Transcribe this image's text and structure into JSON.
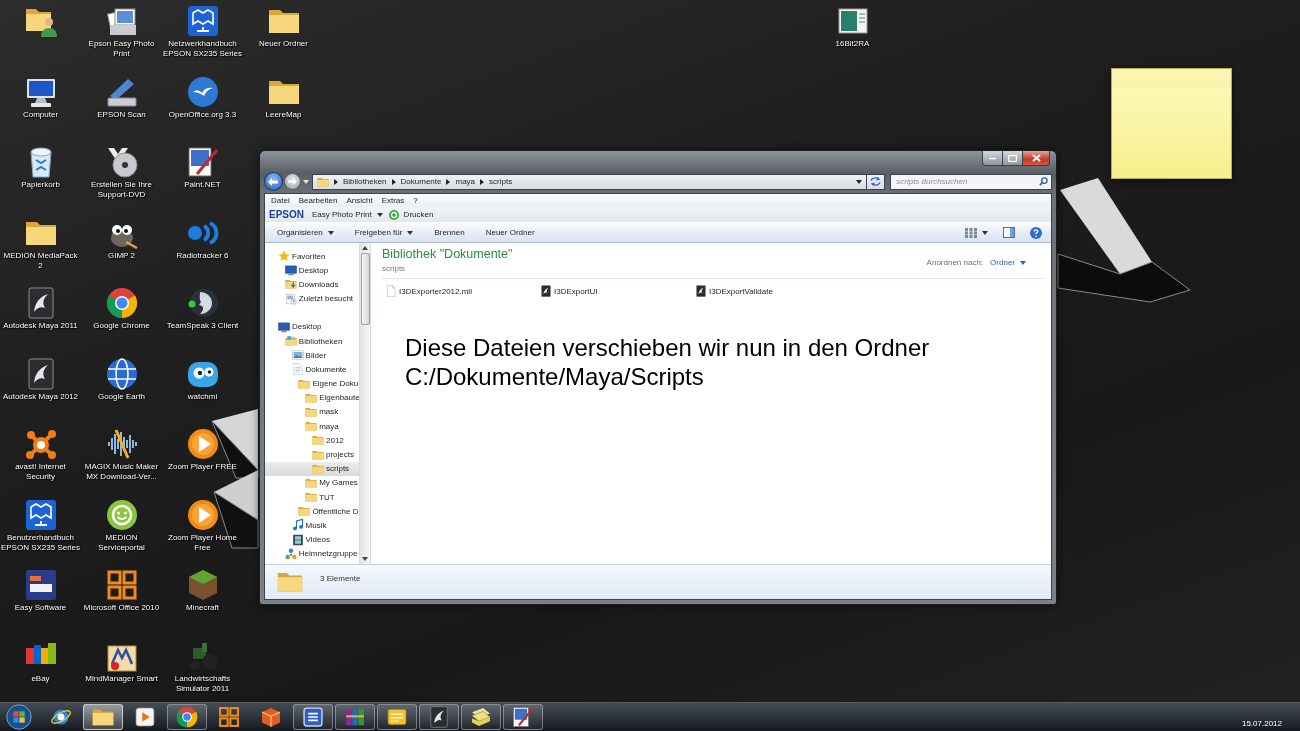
{
  "desktop": {
    "icon_columns": [
      [
        {
          "kind": "user-folder"
        },
        {
          "label": "Computer",
          "kind": "computer"
        },
        {
          "label": "Papierkorb",
          "kind": "trash"
        },
        {
          "label": "MEDION MediaPack 2",
          "kind": "folder"
        },
        {
          "label": "Autodesk Maya 2011",
          "kind": "maya"
        },
        {
          "label": "Autodesk Maya 2012",
          "kind": "maya"
        },
        {
          "label": "avast! Internet Security",
          "kind": "avast"
        },
        {
          "label": "Benutzerhandbuch EPSON SX235 Series",
          "kind": "manual"
        },
        {
          "label": "Easy Software",
          "kind": "mugle"
        },
        {
          "label": "eBay",
          "kind": "ebay"
        }
      ],
      [
        {
          "label": "Epson Easy Photo Print",
          "kind": "photos"
        },
        {
          "label": "EPSON Scan",
          "kind": "scanner"
        },
        {
          "label": "Erstellen Sie Ihre Support-DVD",
          "kind": "disc"
        },
        {
          "label": "GIMP 2",
          "kind": "gimp"
        },
        {
          "label": "Google Chrome",
          "kind": "chrome"
        },
        {
          "label": "Google Earth",
          "kind": "earth"
        },
        {
          "label": "MAGIX Music Maker MX Download-Ver...",
          "kind": "waveform"
        },
        {
          "label": "MEDION Serviceportal",
          "kind": "smiley"
        },
        {
          "label": "Microsoft Office 2010",
          "kind": "office"
        },
        {
          "label": "MindManager Smart",
          "kind": "mindmanager"
        }
      ],
      [
        {
          "label": "Netzwerkhandbuch EPSON SX235 Series",
          "kind": "manual"
        },
        {
          "label": "OpenOffice.org 3.3",
          "kind": "openoffice"
        },
        {
          "label": "Paint.NET",
          "kind": "paint"
        },
        {
          "label": "Radiotracker 6",
          "kind": "radio"
        },
        {
          "label": "TeamSpeak 3 Client",
          "kind": "teamspeak"
        },
        {
          "label": "watchmi",
          "kind": "watchmi"
        },
        {
          "label": "Zoom Player FREE",
          "kind": "play"
        },
        {
          "label": "Zoom Player Home Free",
          "kind": "play"
        },
        {
          "label": "Minecraft",
          "kind": "grass"
        },
        {
          "label": "Landwirtschafts Simulator 2011",
          "kind": "tractor"
        }
      ],
      [
        {
          "label": "Neuer Ordner",
          "kind": "folder"
        },
        {
          "label": "LeereMap",
          "kind": "folder"
        }
      ]
    ],
    "far_icons": [
      {
        "label": "16Bit2RA",
        "kind": "image"
      }
    ]
  },
  "explorer": {
    "history": {
      "back_disabled": false,
      "forward_disabled": true
    },
    "breadcrumb": [
      "Bibliotheken",
      "Dokumente",
      "maya",
      "scripts"
    ],
    "search": {
      "placeholder": "scripts durchsuchen"
    },
    "menu": [
      "Datei",
      "Bearbeiten",
      "Ansicht",
      "Extras",
      "?"
    ],
    "epson_bar": {
      "brand": "EPSON",
      "app": "Easy Photo Print",
      "print": "Drucken"
    },
    "commands": [
      {
        "label": "Organisieren",
        "dropdown": true
      },
      {
        "label": "Freigeben für",
        "dropdown": true
      },
      {
        "label": "Brennen",
        "dropdown": false
      },
      {
        "label": "Neuer Ordner",
        "dropdown": false
      }
    ],
    "nav": [
      {
        "label": "Favoriten",
        "kind": "star",
        "selected": false,
        "children": [
          {
            "label": "Desktop",
            "kind": "desktop",
            "selected": false
          },
          {
            "label": "Downloads",
            "kind": "download",
            "selected": false
          },
          {
            "label": "Zuletzt besucht",
            "kind": "recent",
            "selected": false
          }
        ]
      },
      {
        "label": "Desktop",
        "kind": "desktop",
        "selected": false,
        "children": [
          {
            "label": "Bibliotheken",
            "kind": "library",
            "selected": false,
            "children": [
              {
                "label": "Bilder",
                "kind": "pictures",
                "selected": false
              },
              {
                "label": "Dokumente",
                "kind": "documents",
                "selected": false,
                "children": [
                  {
                    "label": "Eigene Doku",
                    "kind": "folder",
                    "selected": false,
                    "children": [
                      {
                        "label": "Eigenbaute",
                        "kind": "folder",
                        "selected": false
                      },
                      {
                        "label": "mask",
                        "kind": "folder",
                        "selected": false
                      },
                      {
                        "label": "maya",
                        "kind": "folder",
                        "selected": false,
                        "children": [
                          {
                            "label": "2012",
                            "kind": "folder",
                            "selected": false
                          },
                          {
                            "label": "projects",
                            "kind": "folder",
                            "selected": false
                          },
                          {
                            "label": "scripts",
                            "kind": "folder",
                            "selected": true
                          }
                        ]
                      },
                      {
                        "label": "My Games",
                        "kind": "folder",
                        "selected": false
                      },
                      {
                        "label": "TUT",
                        "kind": "folder",
                        "selected": false
                      }
                    ]
                  },
                  {
                    "label": "Öffentliche D",
                    "kind": "folder",
                    "selected": false
                  }
                ]
              },
              {
                "label": "Musik",
                "kind": "music",
                "selected": false
              },
              {
                "label": "Videos",
                "kind": "video",
                "selected": false
              }
            ]
          },
          {
            "label": "Heimnetzgruppe",
            "kind": "homegroup",
            "selected": false
          }
        ]
      }
    ],
    "library": {
      "title": "Bibliothek \"Dokumente\"",
      "subtitle": "scripts",
      "arrange_label": "Anordnen nach:",
      "arrange_value": "Ordner"
    },
    "files": [
      {
        "name": "I3DExporter2012.mll",
        "kind": "file"
      },
      {
        "name": "I3DExportUI",
        "kind": "maya"
      },
      {
        "name": "I3DExportValidate",
        "kind": "maya"
      }
    ],
    "status": "3 Elemente"
  },
  "annotation": "Diese Dateien verschieben wir nun in den Ordner C:/Dokumente/Maya/Scripts",
  "taskbar": {
    "items": [
      {
        "kind": "ie",
        "running": false,
        "active": false
      },
      {
        "kind": "folder",
        "running": true,
        "active": true
      },
      {
        "kind": "media",
        "running": false,
        "active": false
      },
      {
        "kind": "chrome",
        "running": true,
        "active": false
      },
      {
        "kind": "office",
        "running": false,
        "active": false
      },
      {
        "kind": "package",
        "running": false,
        "active": false
      },
      {
        "kind": "s-tile",
        "running": true,
        "active": false
      },
      {
        "kind": "winrar",
        "running": true,
        "active": false
      },
      {
        "kind": "note",
        "running": true,
        "active": false
      },
      {
        "kind": "maya",
        "running": true,
        "active": false
      },
      {
        "kind": "sheets",
        "running": true,
        "active": false
      },
      {
        "kind": "paint",
        "running": true,
        "active": false
      }
    ],
    "date": "15.07.2012"
  }
}
